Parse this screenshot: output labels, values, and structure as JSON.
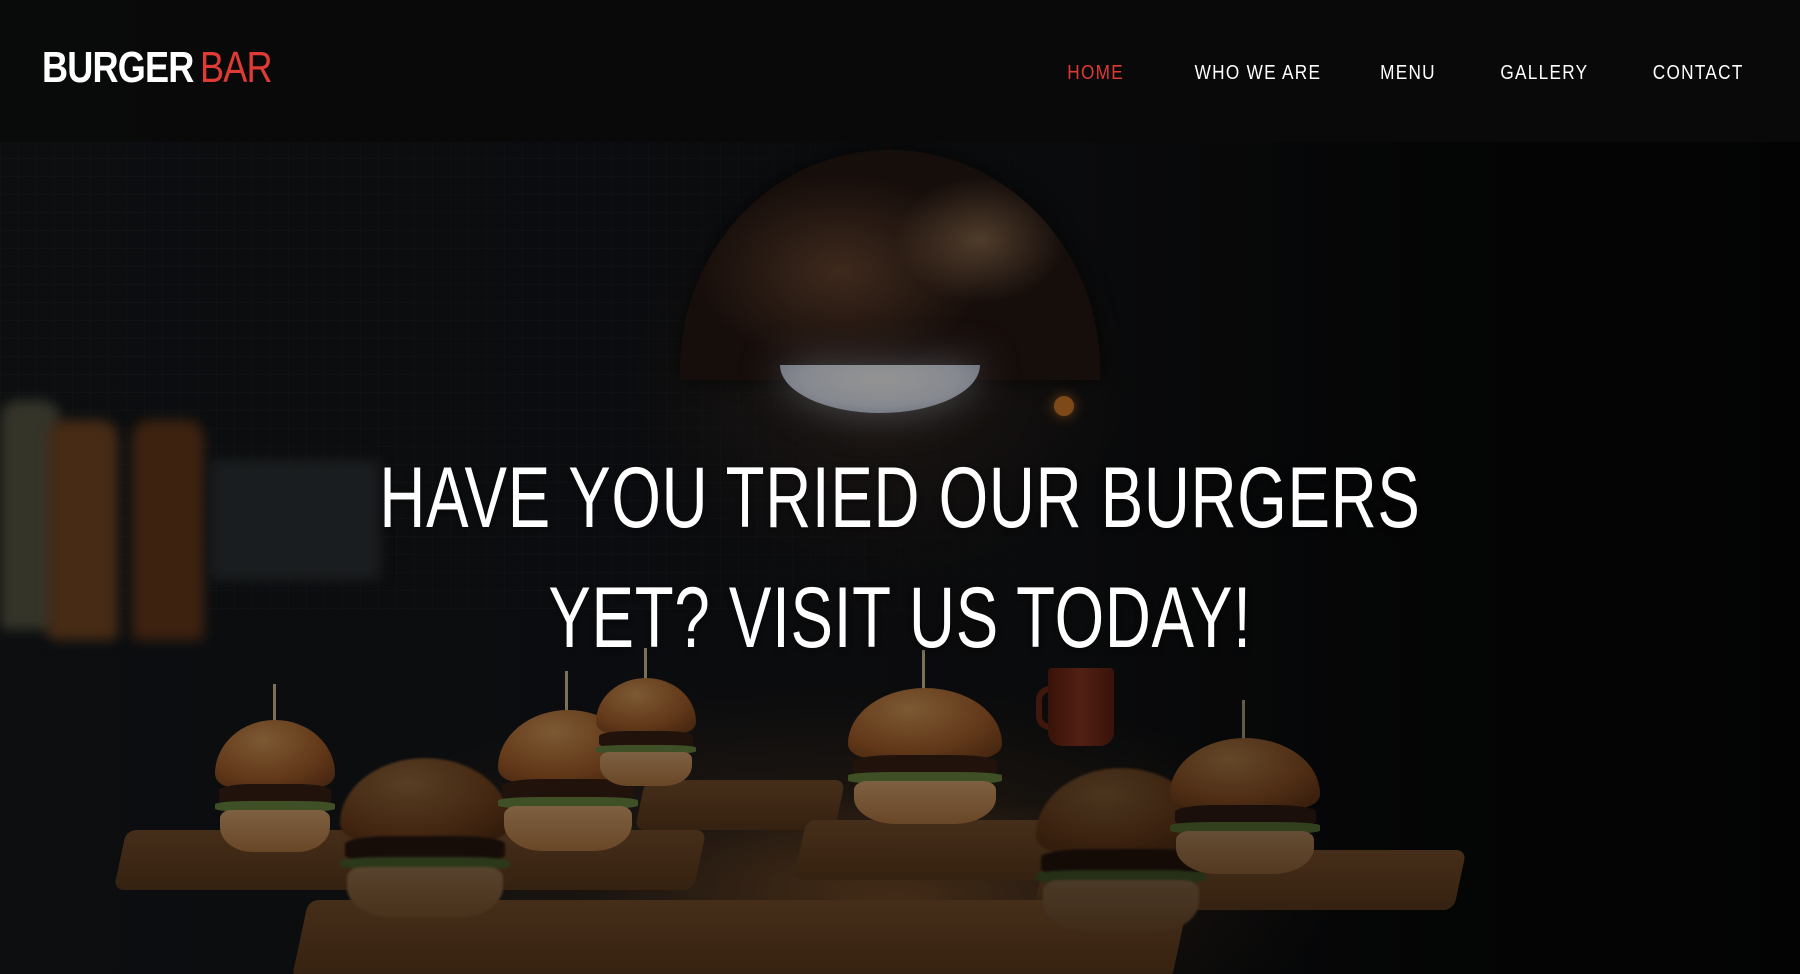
{
  "brand": {
    "primary": "BURGER",
    "accent": "BAR",
    "accent_color": "#e03a34"
  },
  "nav": {
    "items": [
      {
        "label": "HOME",
        "active": true
      },
      {
        "label": "WHO WE ARE",
        "active": false
      },
      {
        "label": "MENU",
        "active": false
      },
      {
        "label": "GALLERY",
        "active": false
      },
      {
        "label": "CONTACT",
        "active": false
      }
    ],
    "active_color": "#e03a34",
    "text_color": "#ffffff"
  },
  "hero": {
    "headline_lines": [
      "HAVE YOU TRIED OUR BURGERS",
      "YET? VISIT US TODAY!"
    ],
    "background": "burger-bar-photo"
  }
}
